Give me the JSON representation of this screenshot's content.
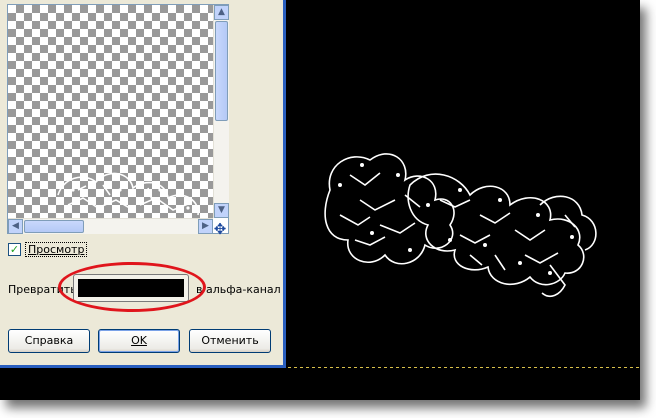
{
  "dialog": {
    "preview_label": "Просмотр",
    "preview_checked": true,
    "convert_prefix": "Превратить",
    "convert_color": "#000000",
    "convert_suffix": "в альфа-канал",
    "buttons": {
      "help": "Справка",
      "ok": "OK",
      "cancel": "Отменить"
    }
  },
  "icons": {
    "scroll_up": "arrow-up-icon",
    "scroll_down": "arrow-down-icon",
    "scroll_left": "arrow-left-icon",
    "scroll_right": "arrow-right-icon",
    "navigate": "navigate-icon",
    "check": "checkmark-icon"
  },
  "colors": {
    "annotation": "#e0151c",
    "canvas": "#000000",
    "dialog_bg": "#ece9d8"
  }
}
